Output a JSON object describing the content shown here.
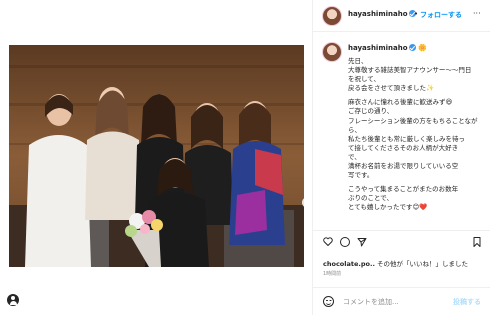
{
  "post": {
    "photo_alt": "",
    "next_icon": "chevron-right-icon"
  },
  "header": {
    "username": "hayashiminaho",
    "separator": "•",
    "follow_label": "フォローする",
    "more_label": "···"
  },
  "caption": {
    "username": "hayashiminaho",
    "flag": "🌼",
    "lines": [
      "先日、",
      "大尊敬する雑誌美智アナウンサー〜〜門日",
      "を祝して、",
      "戻る会をさせて頂きました✨",
      "",
      "麻衣さんに憧れる後輩に歓送みず😆",
      "ご存じの通り、",
      "フレーシーション後輩の方をもちることなが",
      "ら、",
      "私たち後輩とも常に厳しく楽しみを待っ",
      "て接してくださるそのお人柄が大好き",
      "で、",
      "満杯お名前をお湯で限りしていいる空",
      "写です。",
      "",
      "こうやって集まることがまたのお数年",
      "ぶりのことで、",
      "とても嬉しかったです😊❤️"
    ]
  },
  "actions": {
    "heart_icon": "heart-icon",
    "comment_icon": "comment-icon",
    "share_icon": "share-icon",
    "bookmark_icon": "bookmark-icon"
  },
  "likes": {
    "user": "chocolate.po..",
    "text": "その他が「いいね！」しました"
  },
  "time_ago": "1時間前",
  "comment_box": {
    "placeholder": "コメントを追加...",
    "post_label": "投稿する"
  },
  "colors": {
    "accent": "#0095f6",
    "verified": "#3897f0",
    "post_disabled": "#b2dffc"
  }
}
